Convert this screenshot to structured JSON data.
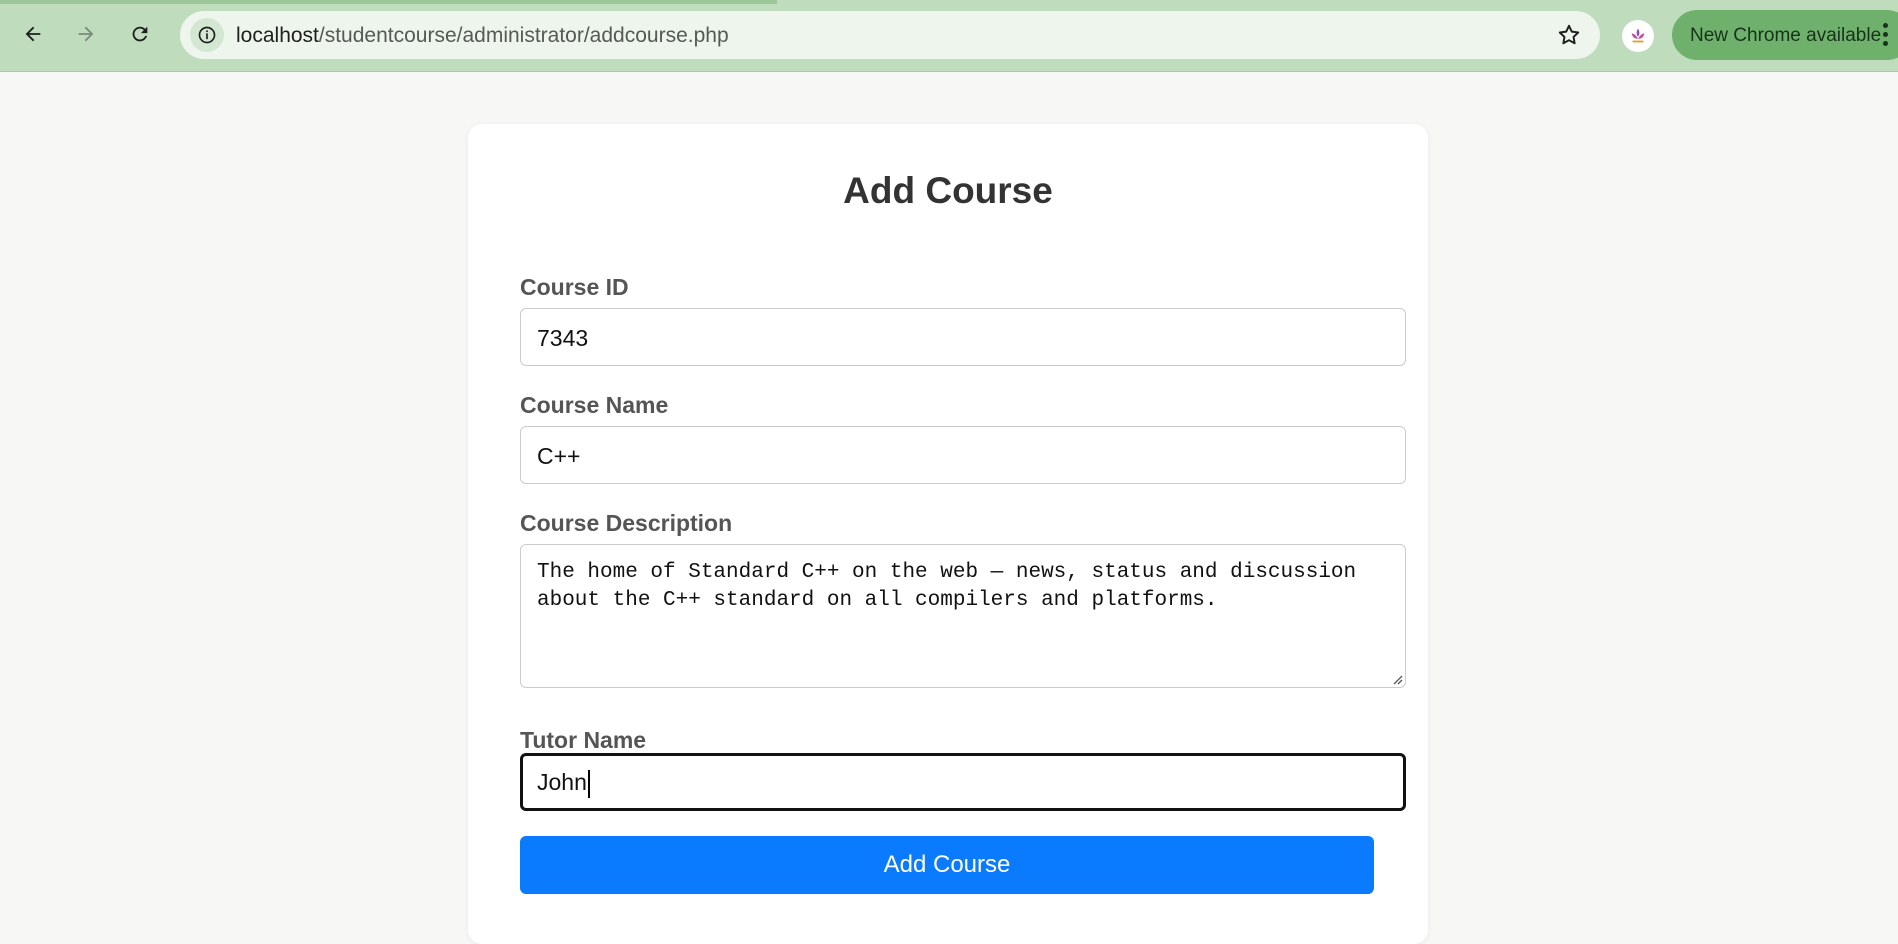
{
  "browser": {
    "url_host": "localhost",
    "url_path": "/studentcourse/administrator/addcourse.php",
    "update_label": "New Chrome available",
    "accent_color": "#bfdcbd"
  },
  "form": {
    "title": "Add Course",
    "course_id": {
      "label": "Course ID",
      "value": "7343"
    },
    "course_name": {
      "label": "Course Name",
      "value": "C++"
    },
    "course_description": {
      "label": "Course Description",
      "value": "The home of Standard C++ on the web — news, status and discussion about the C++ standard on all compilers and platforms."
    },
    "tutor_name": {
      "label": "Tutor Name",
      "value": "John"
    },
    "submit_label": "Add Course",
    "submit_color": "#0a7bff"
  }
}
